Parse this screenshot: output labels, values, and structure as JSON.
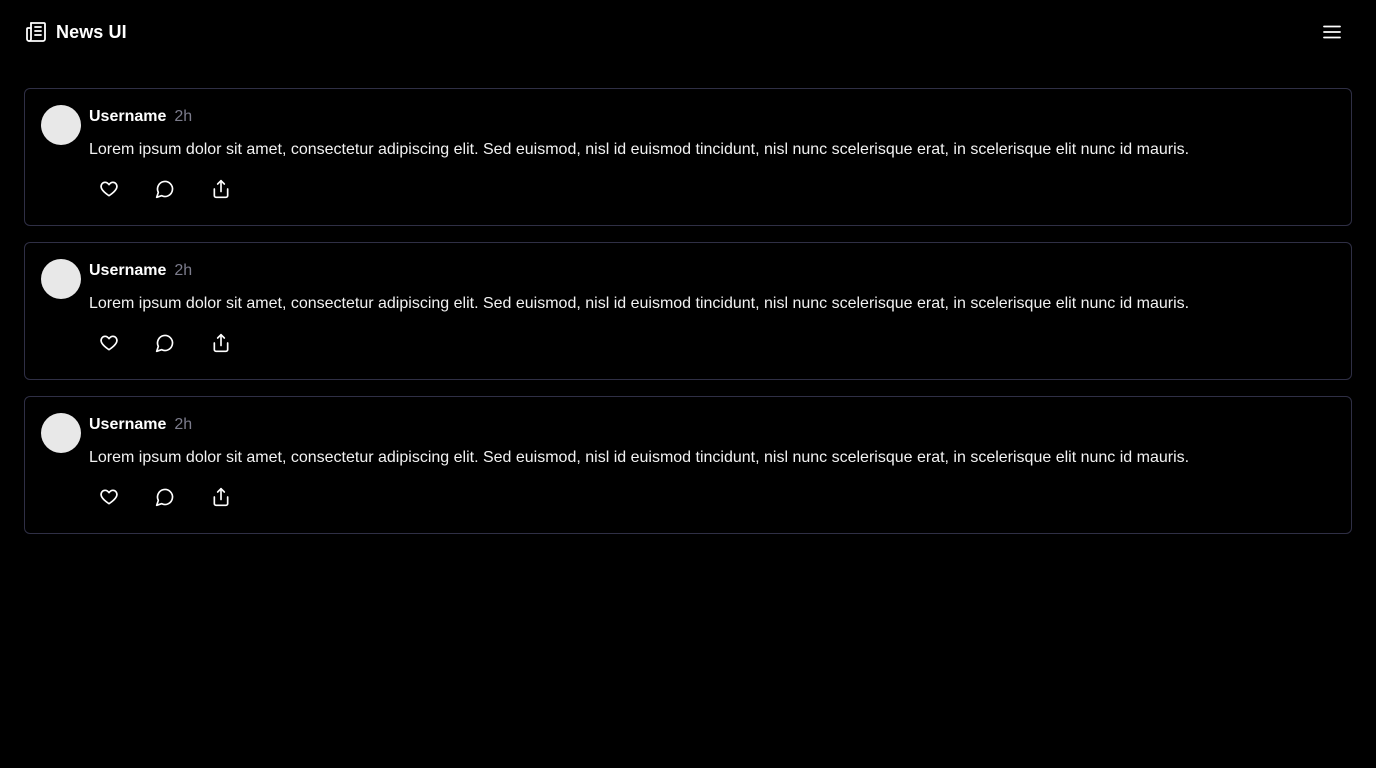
{
  "app": {
    "title": "News UI",
    "logo_icon": "newspaper-icon",
    "menu_icon": "hamburger-menu-icon"
  },
  "colors": {
    "background": "#000000",
    "card_border": "#2f2f45",
    "avatar": "#e8e8e8",
    "muted_text": "#7c7c8c"
  },
  "posts": [
    {
      "username": "Username",
      "time": "2h",
      "text": "Lorem ipsum dolor sit amet, consectetur adipiscing elit. Sed euismod, nisl id euismod tincidunt, nisl nunc scelerisque erat, in scelerisque elit nunc id mauris.",
      "actions": [
        "heart-icon",
        "comment-icon",
        "share-icon"
      ]
    },
    {
      "username": "Username",
      "time": "2h",
      "text": "Lorem ipsum dolor sit amet, consectetur adipiscing elit. Sed euismod, nisl id euismod tincidunt, nisl nunc scelerisque erat, in scelerisque elit nunc id mauris.",
      "actions": [
        "heart-icon",
        "comment-icon",
        "share-icon"
      ]
    },
    {
      "username": "Username",
      "time": "2h",
      "text": "Lorem ipsum dolor sit amet, consectetur adipiscing elit. Sed euismod, nisl id euismod tincidunt, nisl nunc scelerisque erat, in scelerisque elit nunc id mauris.",
      "actions": [
        "heart-icon",
        "comment-icon",
        "share-icon"
      ]
    }
  ]
}
